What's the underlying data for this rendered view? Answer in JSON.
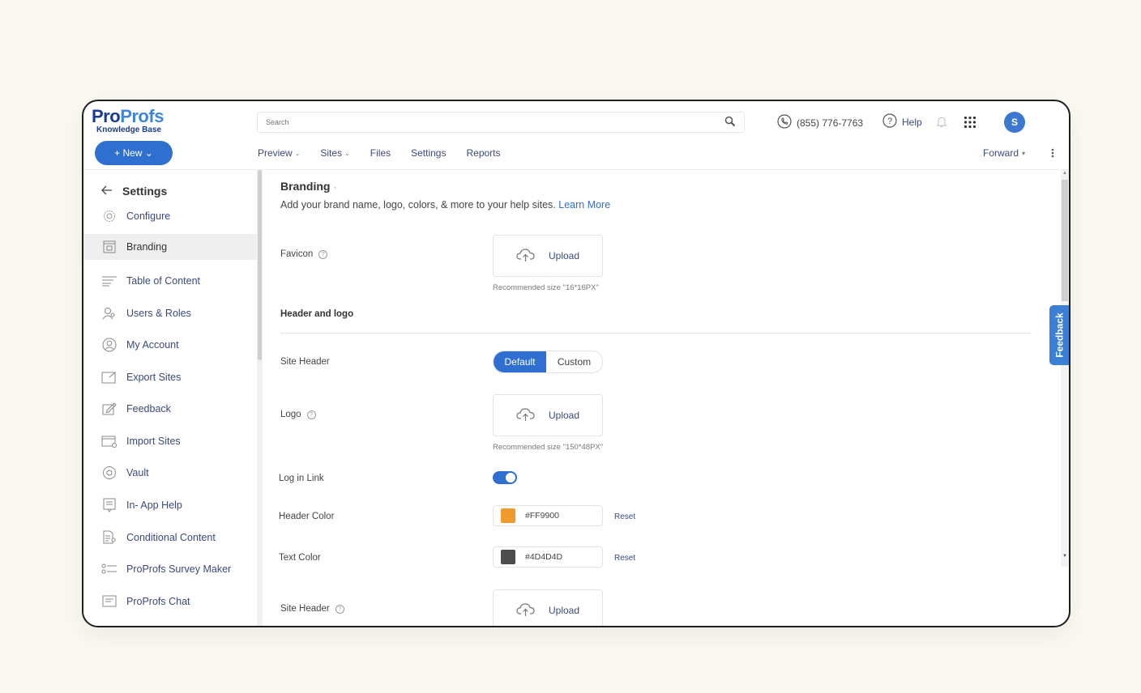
{
  "logo": {
    "brand_part1": "Pro",
    "brand_part2": "Profs",
    "subtitle": "Knowledge Base"
  },
  "search": {
    "placeholder": "Search"
  },
  "header": {
    "phone": "(855) 776-7763",
    "help": "Help",
    "avatar_initial": "S"
  },
  "new_button": "+ New ⌄",
  "nav": {
    "preview": "Preview",
    "sites": "Sites",
    "files": "Files",
    "settings": "Settings",
    "reports": "Reports",
    "forward": "Forward"
  },
  "sidebar": {
    "heading": "Settings",
    "items": [
      {
        "label": "Configure",
        "icon": "configure-icon"
      },
      {
        "label": "Branding",
        "icon": "branding-icon",
        "active": true
      },
      {
        "label": "Table of Content",
        "icon": "toc-icon"
      },
      {
        "label": "Users & Roles",
        "icon": "users-icon"
      },
      {
        "label": "My Account",
        "icon": "account-icon"
      },
      {
        "label": "Export Sites",
        "icon": "export-icon"
      },
      {
        "label": "Feedback",
        "icon": "feedback-icon"
      },
      {
        "label": "Import Sites",
        "icon": "import-icon"
      },
      {
        "label": "Vault",
        "icon": "vault-icon"
      },
      {
        "label": "In- App Help",
        "icon": "inapp-help-icon"
      },
      {
        "label": "Conditional Content",
        "icon": "conditional-icon"
      },
      {
        "label": "ProProfs Survey Maker",
        "icon": "survey-icon"
      },
      {
        "label": "ProProfs Chat",
        "icon": "chat-icon"
      }
    ]
  },
  "main": {
    "title": "Branding",
    "title_dot": "·",
    "description": "Add your brand name, logo, colors, & more to your help sites.",
    "learn_more": "Learn More",
    "favicon_label": "Favicon",
    "upload_label": "Upload",
    "favicon_hint": "Recommended size \"16*16PX\"",
    "section_header_logo": "Header and logo",
    "site_header_label": "Site Header",
    "seg_default": "Default",
    "seg_custom": "Custom",
    "logo_label": "Logo",
    "logo_hint": "Recommended size \"150*48PX\"",
    "login_link_label": "Log in Link",
    "login_link_enabled": true,
    "header_color_label": "Header Color",
    "header_color_value": "#FF9900",
    "header_color_swatch": "#ef9a2d",
    "text_color_label": "Text Color",
    "text_color_value": "#4D4D4D",
    "text_color_swatch": "#4d4d4d",
    "reset_label": "Reset",
    "site_header2_label": "Site Header"
  },
  "feedback_tab": "Feedback",
  "colors": {
    "accent": "#2e6fd0",
    "brand_dark": "#1a3b8f",
    "background": "#fbf8f2"
  }
}
